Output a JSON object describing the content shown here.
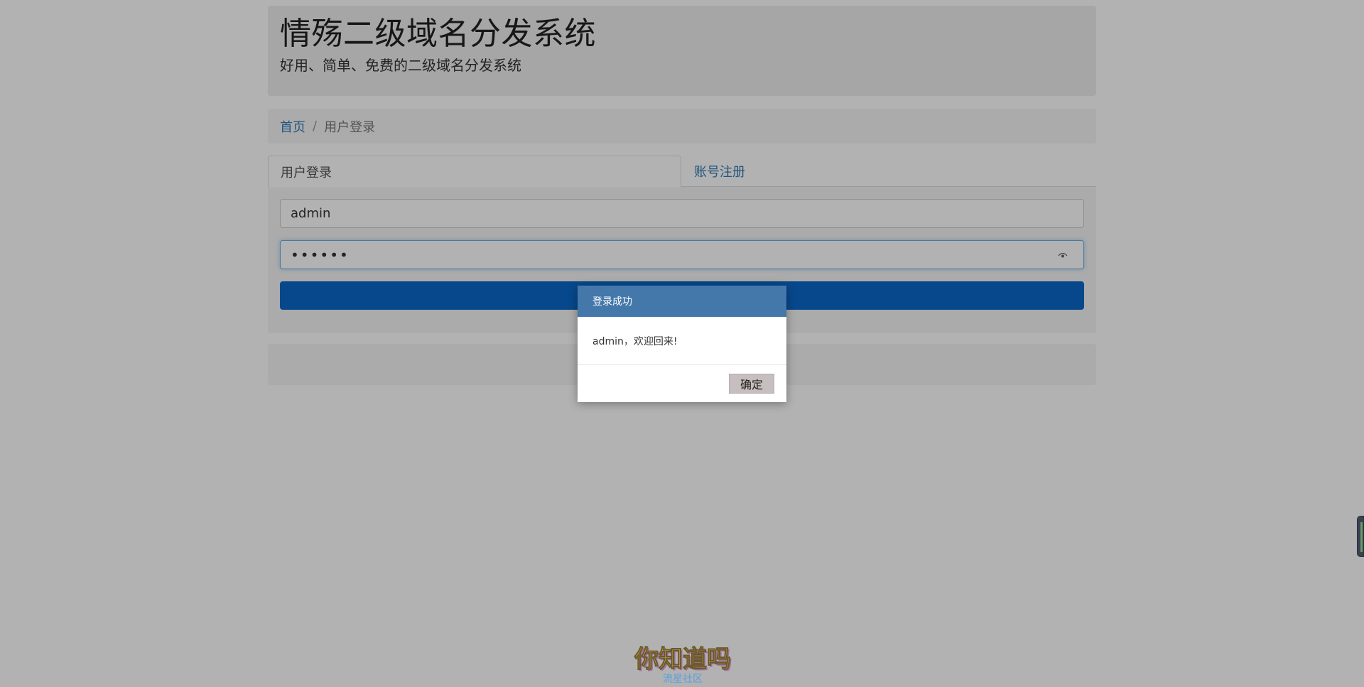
{
  "header": {
    "title": "情殇二级域名分发系统",
    "subtitle": "好用、简单、免费的二级域名分发系统"
  },
  "breadcrumb": {
    "home": "首页",
    "separator": "/",
    "current": "用户登录"
  },
  "tabs": [
    {
      "label": "用户登录",
      "active": true
    },
    {
      "label": "账号注册",
      "active": false
    }
  ],
  "login_form": {
    "username_value": "admin",
    "password_value": "••••••",
    "password_toggle_icon": "eye-icon",
    "submit_color": "#0b67c9"
  },
  "dialog": {
    "title": "登录成功",
    "message": "admin，欢迎回来!",
    "ok_label": "确定",
    "title_bg": "#4477aa"
  },
  "watermark": {
    "main": "你知道吗",
    "sub": "流星社区"
  }
}
